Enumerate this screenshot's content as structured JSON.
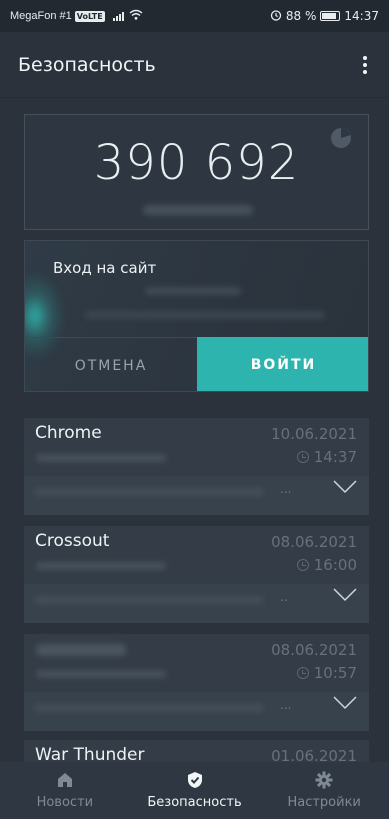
{
  "status_bar": {
    "carrier": "MegaFon #1",
    "volte": "VoLTE",
    "battery": "88 %",
    "time": "14:37",
    "battery_level": 0.88
  },
  "app_bar": {
    "title": "Безопасность",
    "menu_icon": "more-vert-icon"
  },
  "code_card": {
    "code": "390 692",
    "timer_icon": "pie-timer-icon"
  },
  "login_request": {
    "title": "Вход на сайт",
    "cancel_label": "ОТМЕНА",
    "login_label": "ВОЙТИ",
    "accent_color": "#2eb4ae"
  },
  "entries": [
    {
      "name": "Chrome",
      "date": "10.06.2021",
      "time": "14:37",
      "more": "..."
    },
    {
      "name": "Crossout",
      "date": "08.06.2021",
      "time": "16:00",
      "more": ".."
    },
    {
      "name": "",
      "date": "08.06.2021",
      "time": "10:57",
      "more": "..."
    },
    {
      "name": "War Thunder",
      "date": "01.06.2021"
    }
  ],
  "bottom_nav": {
    "items": [
      {
        "label": "Новости",
        "icon": "home-icon"
      },
      {
        "label": "Безопасность",
        "icon": "shield-check-icon",
        "active": true
      },
      {
        "label": "Настройки",
        "icon": "gear-icon"
      }
    ]
  }
}
